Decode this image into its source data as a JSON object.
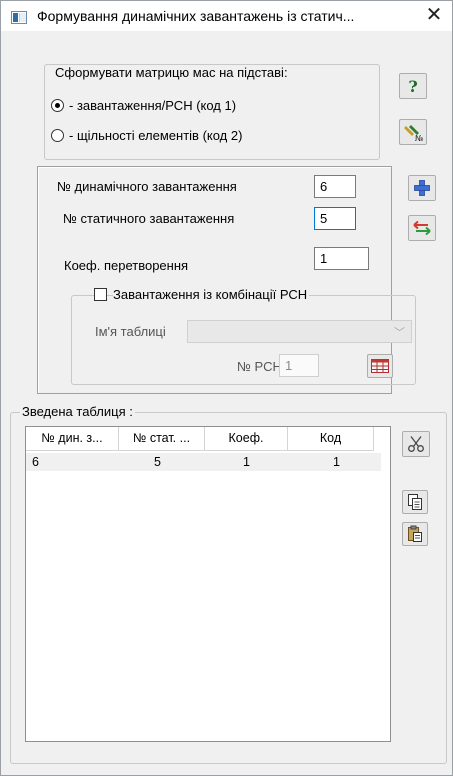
{
  "window": {
    "title": "Формування динамічних завантажень із статич...",
    "close_glyph": "✕"
  },
  "mass_group": {
    "label": "Сформувати матрицю мас на підставі:",
    "option1": "- завантаження/РСН (код 1)",
    "option2": "- щільності елементів (код 2)",
    "selected": "option1"
  },
  "params": {
    "dyn_label": "№  динамічного завантаження",
    "dyn_value": "6",
    "stat_label": "№  статичного завантаження",
    "stat_value": "5",
    "coef_label": "Коеф. перетворення",
    "coef_value": "1",
    "combo_checkbox_label": "Завантаження із комбінації РСН",
    "combo_checked": false,
    "table_name_label": "Ім'я таблиці",
    "table_name_value": "",
    "rsn_label": "№ РСН",
    "rsn_value": "1"
  },
  "summary": {
    "label": "Зведена таблиця :",
    "columns": [
      "№ дин. з...",
      "№ стат. ...",
      "Коеф.",
      "Код"
    ],
    "rows": [
      [
        "6",
        "5",
        "1",
        "1"
      ]
    ]
  },
  "icons": {
    "help": "help-icon",
    "settings": "numbered-tool-icon",
    "add": "add-icon",
    "swap": "swap-arrows-icon",
    "rsn_table": "table-grid-icon",
    "cut": "cut-icon",
    "copy": "copy-icon",
    "paste": "paste-icon"
  },
  "colors": {
    "accent_focus": "#0078d7",
    "add_blue": "#3c6fd1",
    "swap_red": "#d23a2e",
    "swap_green": "#2e9b3e"
  }
}
